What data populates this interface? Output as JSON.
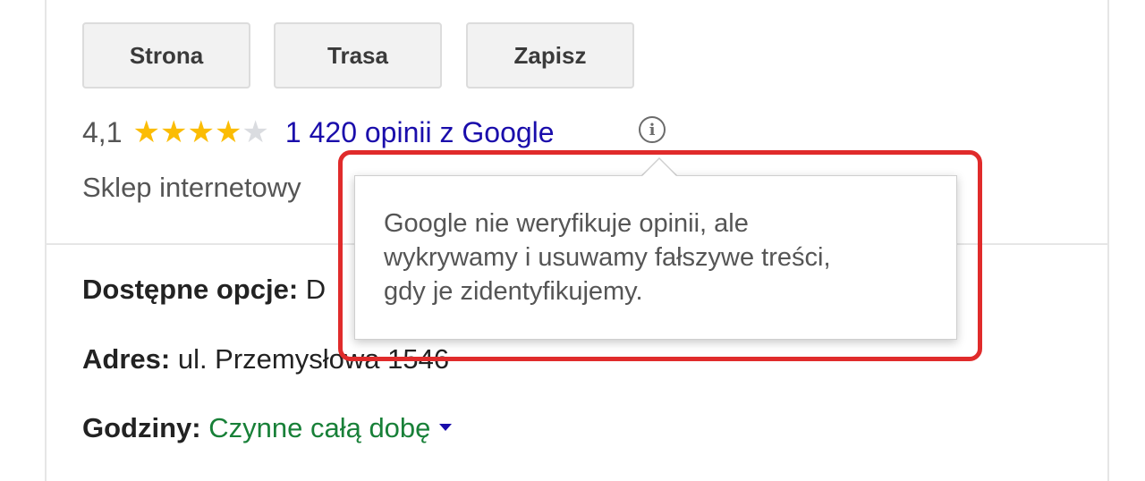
{
  "actions": {
    "website_label": "Strona",
    "directions_label": "Trasa",
    "save_label": "Zapisz"
  },
  "rating": {
    "value": "4,1",
    "stars_filled": 4,
    "stars_total": 5,
    "reviews_link": "1 420 opinii z Google",
    "star_color": "#fbbc04",
    "star_empty_color": "#dadce0"
  },
  "category": "Sklep internetowy",
  "info": {
    "options_label": "Dostępne opcje:",
    "options_value": "D",
    "address_label": "Adres:",
    "address_value": "ul. Przemysłowa 1546",
    "hours_label": "Godziny:",
    "hours_value": "Czynne całą dobę"
  },
  "tooltip": {
    "text_line1": "Google nie weryfikuje opinii, ale",
    "text_line2": "wykrywamy i usuwamy fałszywe treści,",
    "text_line3": "gdy je zidentyfikujemy."
  },
  "icons": {
    "info": "info-icon",
    "star": "star-icon",
    "dropdown": "caret-down-icon"
  },
  "colors": {
    "link": "#1a0dab",
    "hours_open": "#188038",
    "highlight": "#e02b2b"
  }
}
